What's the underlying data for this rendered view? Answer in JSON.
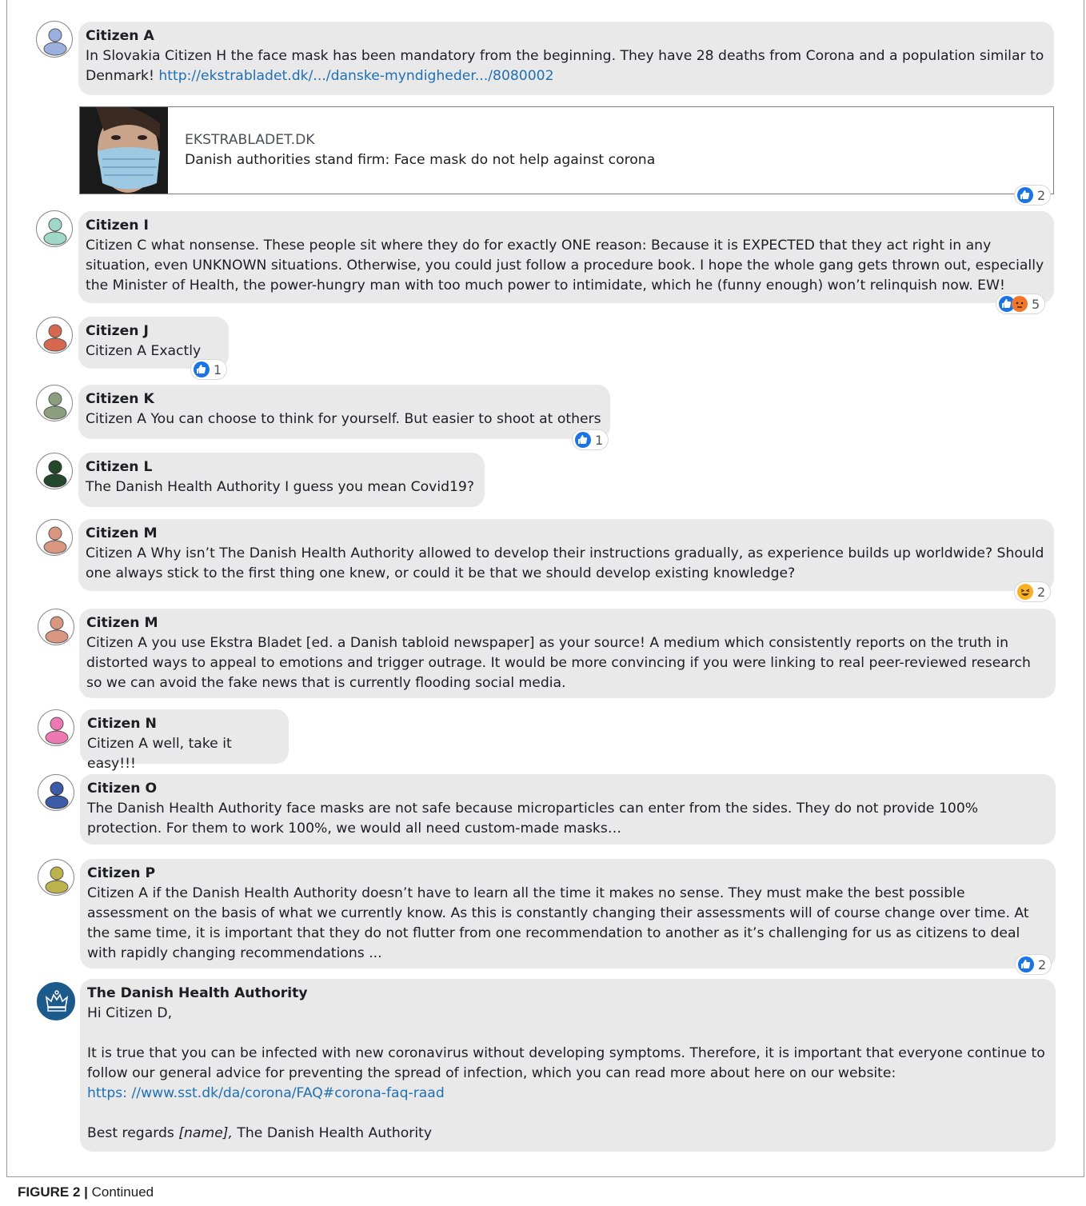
{
  "comments": [
    {
      "author": "Citizen A",
      "text": "In Slovakia Citizen H the face mask has been mandatory from the beginning. They have 28 deaths from Corona and a population similar to Denmark! ",
      "link": "http://ekstrabladet.dk/.../danske-myndigheder.../8080002"
    },
    {
      "author": "Citizen I",
      "text": "Citizen C what nonsense. These people sit where they do for exactly ONE reason: Because it is EXPECTED that they act right in any situation, even UNKNOWN situations. Otherwise, you could just follow a procedure book. I hope the whole gang gets thrown out, especially the Minister of Health, the power-hungry man with too much power to intimidate, which he (funny enough) won’t relinquish now. EW!",
      "reaction_count": "5"
    },
    {
      "author": "Citizen J",
      "text": "Citizen A Exactly",
      "reaction_count": "1"
    },
    {
      "author": "Citizen K",
      "text": "Citizen A You can choose to think for yourself. But easier to shoot at others",
      "reaction_count": "1"
    },
    {
      "author": "Citizen L",
      "text": "The Danish Health Authority I guess you mean Covid19?"
    },
    {
      "author": "Citizen M",
      "text": "Citizen A Why isn’t The Danish Health Authority allowed to develop their instructions gradually, as experience builds up worldwide? Should one always stick to the first thing one knew, or could it be that we should develop existing knowledge?",
      "reaction_count": "2"
    },
    {
      "author": "Citizen M",
      "text": "Citizen A you use Ekstra Bladet [ed. a Danish tabloid newspaper] as your source! A medium which consistently reports on the truth in distorted ways to appeal to emotions and trigger outrage. It would be more convincing if you were linking to real peer-reviewed research so we can avoid the fake news that is currently flooding social media."
    },
    {
      "author": "Citizen N",
      "text": "Citizen A well, take it easy!!!"
    },
    {
      "author": "Citizen O",
      "text": "The Danish Health Authority face masks are not safe because microparticles can enter from the sides. They do not provide 100% protection. For them to work 100%, we would all need custom-made masks…"
    },
    {
      "author": "Citizen P",
      "text": "Citizen A if the Danish Health Authority doesn’t have to learn all the time it makes no sense. They must make the best possible assessment on the basis of what we currently know. As this is constantly changing their assessments will of course change over time. At the same time, it is important that they do not flutter from one recommendation to another as it’s challenging for us as citizens to deal with rapidly changing recommendations ...",
      "reaction_count": "2"
    }
  ],
  "preview": {
    "domain": "EKSTRABLADET.DK",
    "title": "Danish authorities stand firm: Face mask do not help against corona",
    "reaction_count": "2"
  },
  "authority_reply": {
    "author": "The Danish Health Authority",
    "greeting": "Hi Citizen D,",
    "body": "It is true that you can be infected with new coronavirus without developing symptoms. Therefore, it is important that everyone continue to follow our general advice for preventing the spread of infection, which you can read more about here on our website:",
    "link": "https: //www.sst.dk/da/corona/FAQ#corona-faq-raad",
    "signoff_prefix": "Best regards ",
    "signoff_name": "[name],",
    "signoff_suffix": " The Danish Health Authority"
  },
  "caption": {
    "label": "FIGURE 2 |",
    "text": " Continued"
  },
  "colors": {
    "bubble": "#e9e9ea",
    "link": "#1f6fb3",
    "like": "#1b74e4",
    "angry": "#f0772a",
    "haha": "#f7b125",
    "avatars": [
      "#9bb0de",
      "#9fd8c9",
      "#d5684f",
      "#8b9e7d",
      "#24482c",
      "#d99680",
      "#d99680",
      "#ee79b2",
      "#3c5ca8",
      "#bcb34c"
    ]
  }
}
